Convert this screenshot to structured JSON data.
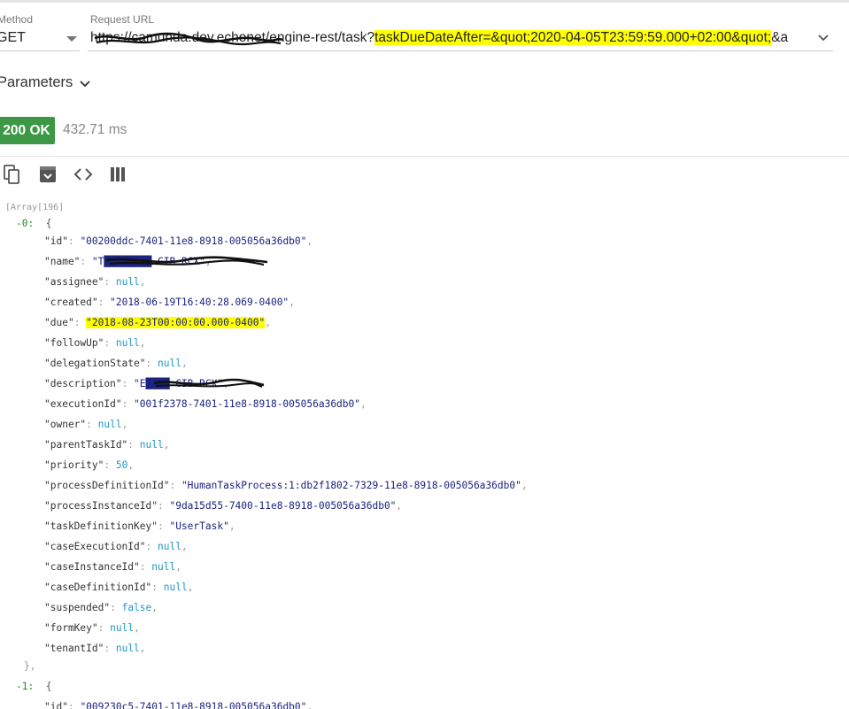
{
  "request": {
    "method_label": "Method",
    "method_value": "GET",
    "url_label": "Request URL",
    "url_prefix": "https://camunda.dev.echonet/engine-rest/task?",
    "url_highlighted": "taskDueDateAfter=&quot;2020-04-05T23:59:59.000+02:00&quot;",
    "url_suffix": "&a"
  },
  "parameters_label": "Parameters",
  "response": {
    "status": "200 OK",
    "time": "432.71 ms",
    "status_color": "#3c9845"
  },
  "toolbar": {
    "icons": [
      "copy-icon",
      "download-icon",
      "code-icon",
      "columns-icon"
    ]
  },
  "json_view": {
    "array_label": "[Array[196]",
    "item0_index": "-0:",
    "item1_index": "-1:",
    "open_brace": "{",
    "close_brace": "},",
    "fields": [
      {
        "key": "\"id\"",
        "value": "\"00200ddc-7401-11e8-8918-005056a36db0\"",
        "type": "string"
      },
      {
        "key": "\"name\"",
        "value": "\"T████████ CIB RCX\"",
        "type": "string"
      },
      {
        "key": "\"assignee\"",
        "value": "null",
        "type": "null"
      },
      {
        "key": "\"created\"",
        "value": "\"2018-06-19T16:40:28.069-0400\"",
        "type": "string"
      },
      {
        "key": "\"due\"",
        "value": "\"2018-08-23T00:00:00.000-0400\"",
        "type": "string"
      },
      {
        "key": "\"followUp\"",
        "value": "null",
        "type": "null"
      },
      {
        "key": "\"delegationState\"",
        "value": "null",
        "type": "null"
      },
      {
        "key": "\"description\"",
        "value": "\"E████ CIB RCX\"",
        "type": "string"
      },
      {
        "key": "\"executionId\"",
        "value": "\"001f2378-7401-11e8-8918-005056a36db0\"",
        "type": "string"
      },
      {
        "key": "\"owner\"",
        "value": "null",
        "type": "null"
      },
      {
        "key": "\"parentTaskId\"",
        "value": "null",
        "type": "null"
      },
      {
        "key": "\"priority\"",
        "value": "50",
        "type": "number"
      },
      {
        "key": "\"processDefinitionId\"",
        "value": "\"HumanTaskProcess:1:db2f1802-7329-11e8-8918-005056a36db0\"",
        "type": "string"
      },
      {
        "key": "\"processInstanceId\"",
        "value": "\"9da15d55-7400-11e8-8918-005056a36db0\"",
        "type": "string"
      },
      {
        "key": "\"taskDefinitionKey\"",
        "value": "\"UserTask\"",
        "type": "string"
      },
      {
        "key": "\"caseExecutionId\"",
        "value": "null",
        "type": "null"
      },
      {
        "key": "\"caseInstanceId\"",
        "value": "null",
        "type": "null"
      },
      {
        "key": "\"caseDefinitionId\"",
        "value": "null",
        "type": "null"
      },
      {
        "key": "\"suspended\"",
        "value": "false",
        "type": "bool"
      },
      {
        "key": "\"formKey\"",
        "value": "null",
        "type": "null"
      },
      {
        "key": "\"tenantId\"",
        "value": "null",
        "type": "null"
      }
    ],
    "item1_first_key": "\"id\"",
    "item1_first_value": "\"009230c5-7401-11e8-8918-005056a36db0\""
  },
  "highlight_color": "#ffff00"
}
